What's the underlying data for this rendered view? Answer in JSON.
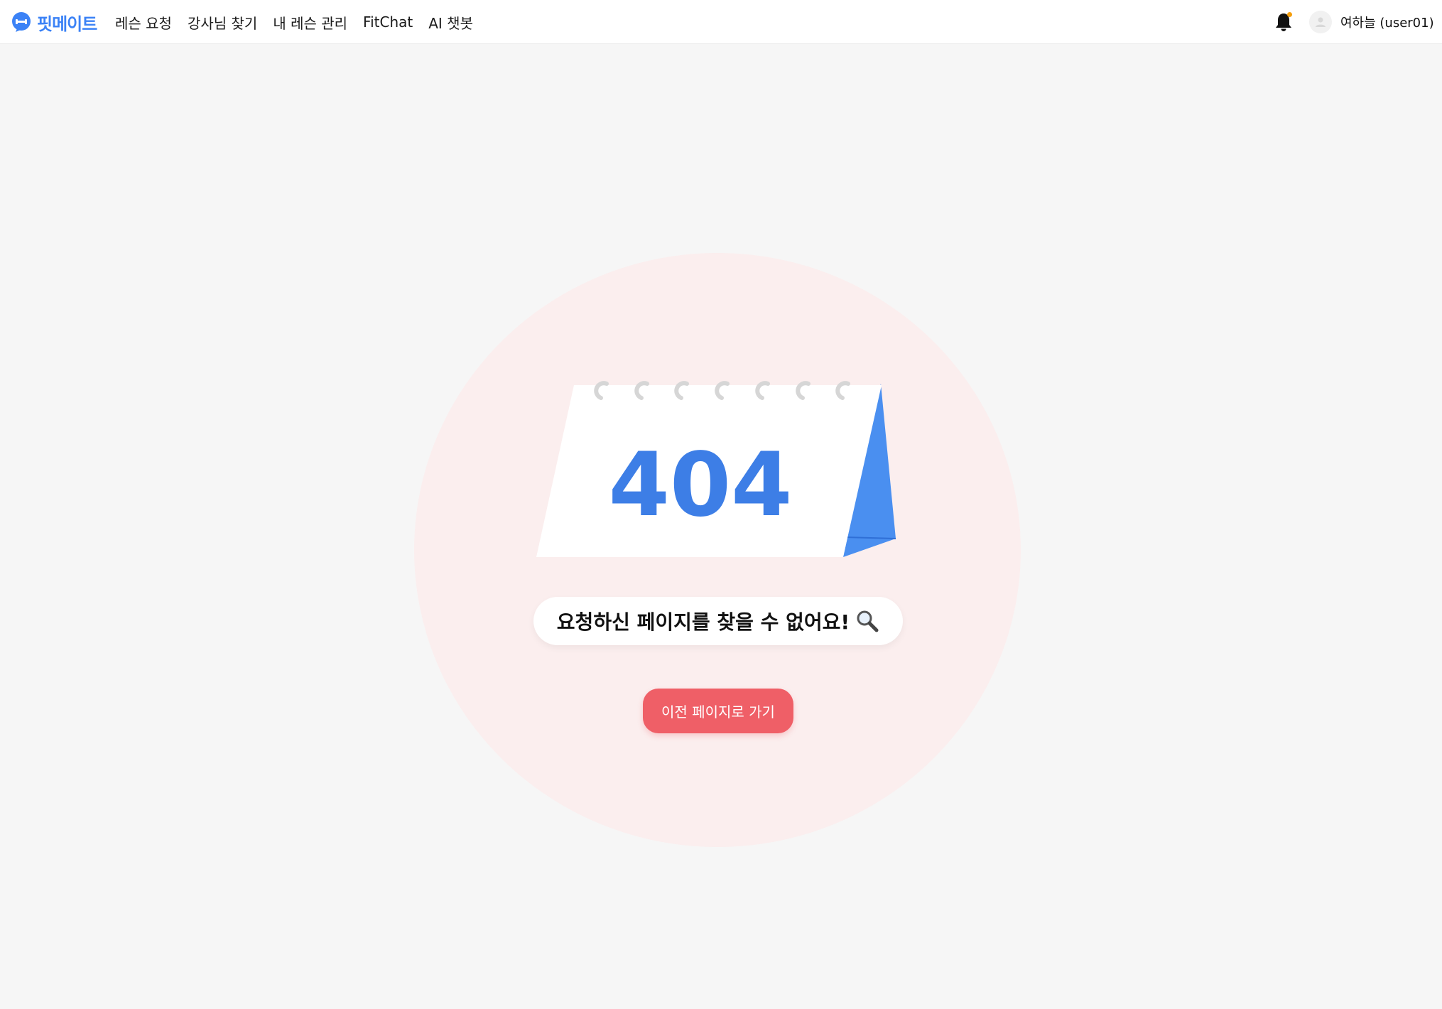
{
  "header": {
    "logo_text": "핏메이트",
    "nav": [
      {
        "label": "레슨 요청"
      },
      {
        "label": "강사님 찾기"
      },
      {
        "label": "내 레슨 관리"
      },
      {
        "label": "FitChat"
      },
      {
        "label": "AI 챗봇"
      }
    ],
    "user_name": "여하늘 (user01)",
    "notification_dot_color": "#f59e0b"
  },
  "main": {
    "error_code": "404",
    "message": "요청하신 페이지를 찾을 수 없어요!",
    "back_button_label": "이전 페이지로 가기"
  },
  "colors": {
    "brand_blue": "#3b82f6",
    "accent_red": "#ef5f67",
    "circle_pink": "#fbeeee",
    "background": "#f6f6f6"
  }
}
